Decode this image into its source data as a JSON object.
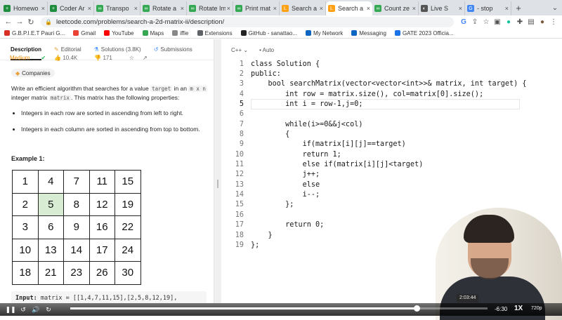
{
  "browser": {
    "tabs": [
      {
        "title": "Homewo",
        "color": "#1e8e3e",
        "glyph": "+"
      },
      {
        "title": "Coder Ar",
        "color": "#1e8e3e",
        "glyph": "+"
      },
      {
        "title": "Transpo",
        "color": "#34a853",
        "glyph": "∞"
      },
      {
        "title": "Rotate a",
        "color": "#34a853",
        "glyph": "∞"
      },
      {
        "title": "Rotate Im",
        "color": "#34a853",
        "glyph": "∞"
      },
      {
        "title": "Print mat",
        "color": "#34a853",
        "glyph": "∞"
      },
      {
        "title": "Search a",
        "color": "#ffa116",
        "glyph": "L"
      },
      {
        "title": "Search a",
        "color": "#ffa116",
        "glyph": "L",
        "active": true
      },
      {
        "title": "Count ze",
        "color": "#34a853",
        "glyph": "∞"
      },
      {
        "title": "Live S",
        "color": "#555555",
        "glyph": "◐"
      },
      {
        "title": "- stop",
        "color": "#4285f4",
        "glyph": "G"
      }
    ],
    "url": "leetcode.com/problems/search-a-2d-matrix-ii/description/",
    "bookmarks": [
      {
        "label": "G.B.P.I.E.T Pauri G...",
        "color": "#d93025"
      },
      {
        "label": "Gmail",
        "color": "#ea4335"
      },
      {
        "label": "YouTube",
        "color": "#ff0000"
      },
      {
        "label": "Maps",
        "color": "#34a853"
      },
      {
        "label": "iffie",
        "color": "#888888"
      },
      {
        "label": "Extensions",
        "color": "#5f6368"
      },
      {
        "label": "GitHub - sanattao...",
        "color": "#222222"
      },
      {
        "label": "My Network",
        "color": "#0a66c2"
      },
      {
        "label": "Messaging",
        "color": "#0a66c2"
      },
      {
        "label": "GATE 2023 Officia...",
        "color": "#1a73e8"
      }
    ]
  },
  "problem": {
    "tabs": [
      "Description",
      "Editorial",
      "Solutions (3.8K)",
      "Submissions"
    ],
    "difficulty": "Medium",
    "likes": "10.4K",
    "dislikes": "171",
    "companies": "Companies",
    "desc_1": "Write an efficient algorithm that searches for a value ",
    "code_target": "target",
    "desc_2": " in an ",
    "code_mxn": "m x n",
    "desc_3": " integer matrix ",
    "code_matrix": "matrix",
    "desc_4": ". This matrix has the following properties:",
    "bullets": [
      "Integers in each row are sorted in ascending from left to right.",
      "Integers in each column are sorted in ascending from top to bottom."
    ],
    "example_title": "Example 1:",
    "matrix": [
      [
        "1",
        "4",
        "7",
        "11",
        "15"
      ],
      [
        "2",
        "5",
        "8",
        "12",
        "19"
      ],
      [
        "3",
        "6",
        "9",
        "16",
        "22"
      ],
      [
        "10",
        "13",
        "14",
        "17",
        "24"
      ],
      [
        "18",
        "21",
        "23",
        "26",
        "30"
      ]
    ],
    "highlighted": "5",
    "input_label": "Input:",
    "input_value": "matrix = [[1,4,7,11,15],[2,5,8,12,19],"
  },
  "editor": {
    "language": "C++",
    "mode": "Auto",
    "current_line": 5,
    "lines": [
      "class Solution {",
      "public:",
      "    bool searchMatrix(vector<vector<int>>& matrix, int target) {",
      "        int row = matrix.size(), col=matrix[0].size();",
      "        int i = row-1,j=0;",
      "",
      "        while(i>=0&&j<col)",
      "        {",
      "            if(matrix[i][j]==target)",
      "            return 1;",
      "            else if(matrix[i][j]<target)",
      "            j++;",
      "            else",
      "            i--;",
      "        };",
      "",
      "        return 0;",
      "    }",
      "};"
    ]
  },
  "player": {
    "tooltip": "2:03:44",
    "remaining": "-6:30",
    "speed": "1X",
    "quality": "720p",
    "progress_percent": 83
  }
}
